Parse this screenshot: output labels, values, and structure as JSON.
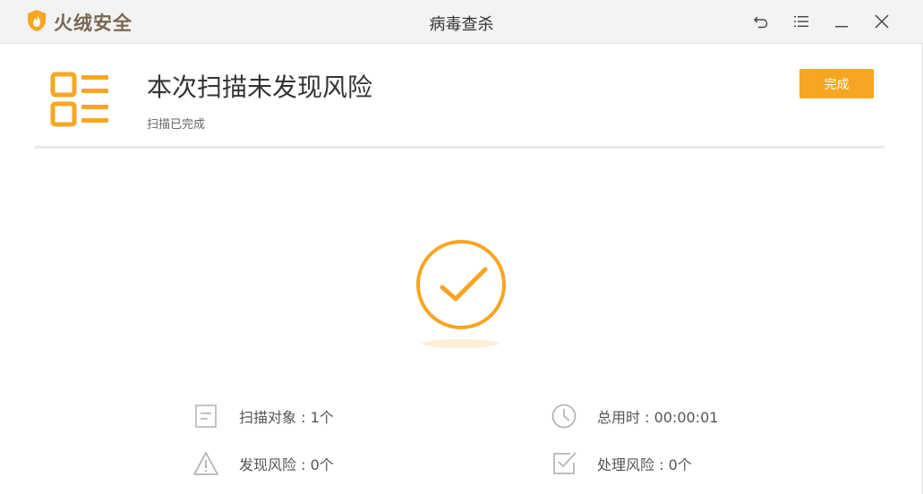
{
  "app": {
    "brand_name": "火绒安全",
    "window_title": "病毒查杀"
  },
  "titlebar": {
    "controls": [
      "back-icon",
      "menu-icon",
      "minimize-icon",
      "close-icon"
    ]
  },
  "result": {
    "headline": "本次扫描未发现风险",
    "status": "扫描已完成",
    "done_label": "完成"
  },
  "stats": {
    "scanned_objects": "扫描对象 : 1个",
    "total_time": "总用时 : 00:00:01",
    "risks_found": "发现风险 : 0个",
    "risks_handled": "处理风险 : 0个"
  },
  "colors": {
    "accent": "#f7a623",
    "brand_text": "#7a6750",
    "icon_gray": "#b5b5b5"
  }
}
